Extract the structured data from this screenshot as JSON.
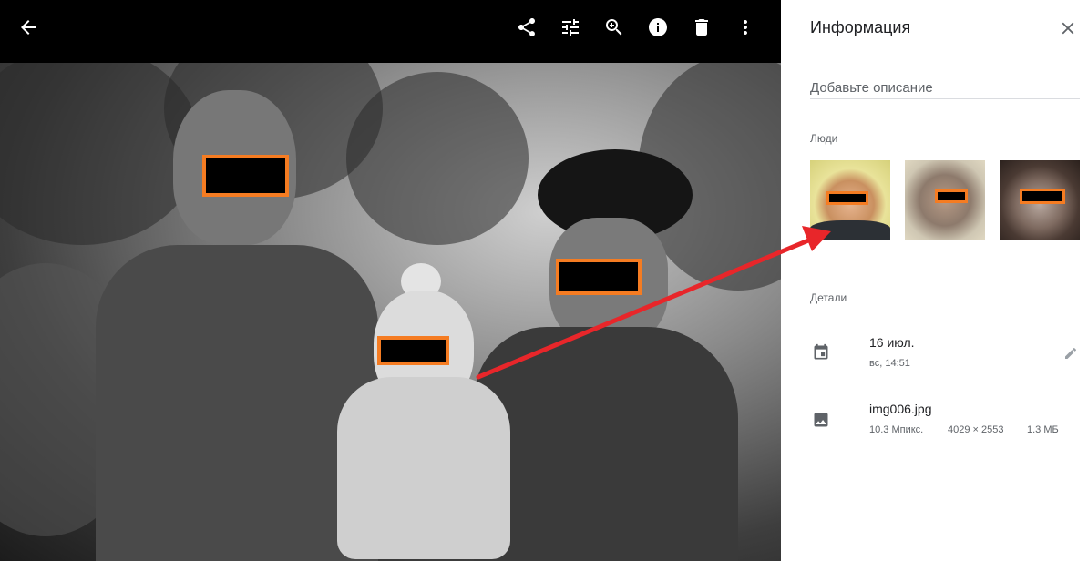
{
  "viewer": {
    "toolbar": {
      "back_icon": "arrow-back-icon",
      "share_icon": "share-icon",
      "edit_icon": "tune-sliders-icon",
      "zoom_icon": "zoom-in-icon",
      "info_icon": "info-icon",
      "delete_icon": "trash-icon",
      "more_icon": "more-vertical-icon"
    },
    "redaction_color": "#f57c22",
    "annotation_arrow_color": "#e8262a"
  },
  "info_panel": {
    "title": "Информация",
    "close_icon": "close-icon",
    "description_placeholder": "Добавьте описание",
    "people_label": "Люди",
    "people": [
      {
        "name": "person-1"
      },
      {
        "name": "person-2"
      },
      {
        "name": "person-3"
      }
    ],
    "details_label": "Детали",
    "date": {
      "icon": "calendar-icon",
      "value": "16 июл.",
      "sub": "вс, 14:51",
      "edit_icon": "pencil-icon"
    },
    "file": {
      "icon": "image-icon",
      "name": "img006.jpg",
      "megapixels": "10.3 Мпикс.",
      "dimensions": "4029 × 2553",
      "size": "1.3 МБ"
    }
  }
}
